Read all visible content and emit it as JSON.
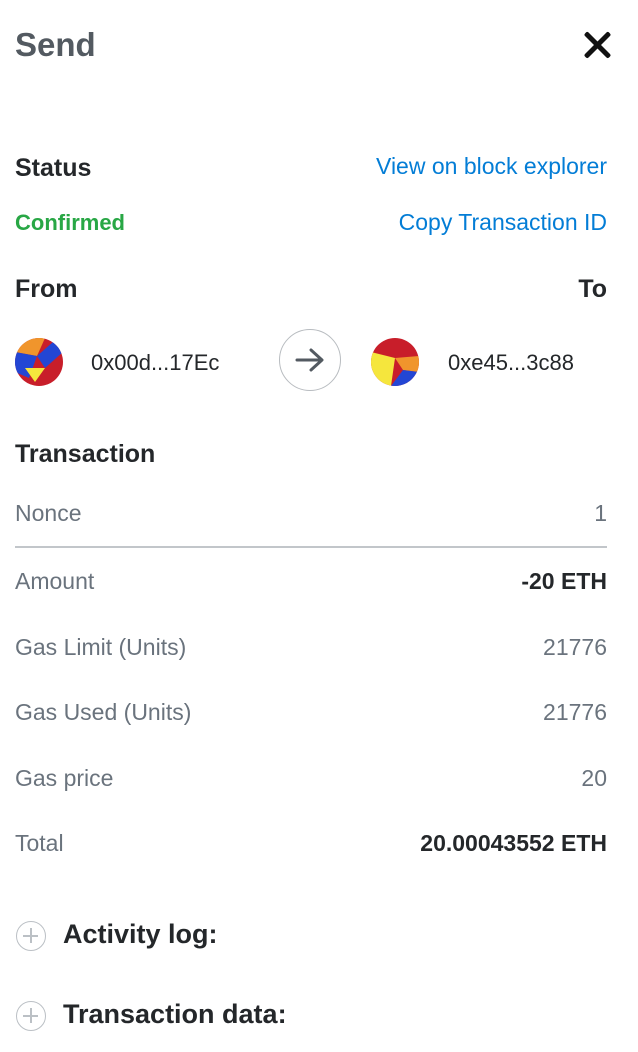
{
  "header": {
    "title": "Send"
  },
  "status": {
    "label": "Status",
    "value": "Confirmed",
    "explorer_link": "View on block explorer",
    "copy_link": "Copy Transaction ID"
  },
  "transfer": {
    "from_label": "From",
    "to_label": "To",
    "from_address": "0x00d...17Ec",
    "to_address": "0xe45...3c88"
  },
  "transaction": {
    "heading": "Transaction",
    "rows": [
      {
        "label": "Nonce",
        "value": "1"
      },
      {
        "label": "Amount",
        "value": "-20 ETH"
      },
      {
        "label": "Gas Limit (Units)",
        "value": "21776"
      },
      {
        "label": "Gas Used (Units)",
        "value": "21776"
      },
      {
        "label": "Gas price",
        "value": "20"
      },
      {
        "label": "Total",
        "value": "20.00043552 ETH"
      }
    ]
  },
  "expanders": {
    "activity_log": "Activity log:",
    "transaction_data": "Transaction data:"
  },
  "colors": {
    "link": "#037dd6",
    "confirmed": "#28a745"
  }
}
